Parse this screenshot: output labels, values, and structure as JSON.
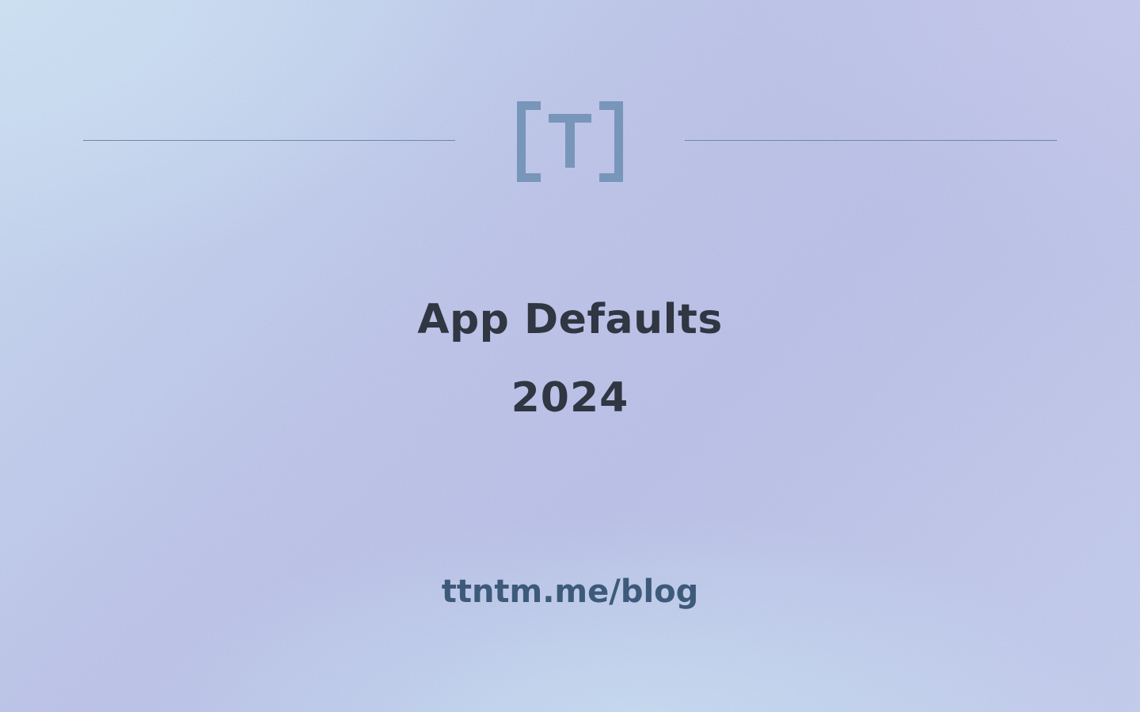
{
  "logo": {
    "name": "bracket-t-logo",
    "text": "[T]",
    "color": "#7896ba"
  },
  "title": "App Defaults",
  "year": "2024",
  "link": "ttntm.me/blog",
  "colors": {
    "title": "#303642",
    "link": "#3d5a7a",
    "rule": "#6e88a8"
  }
}
